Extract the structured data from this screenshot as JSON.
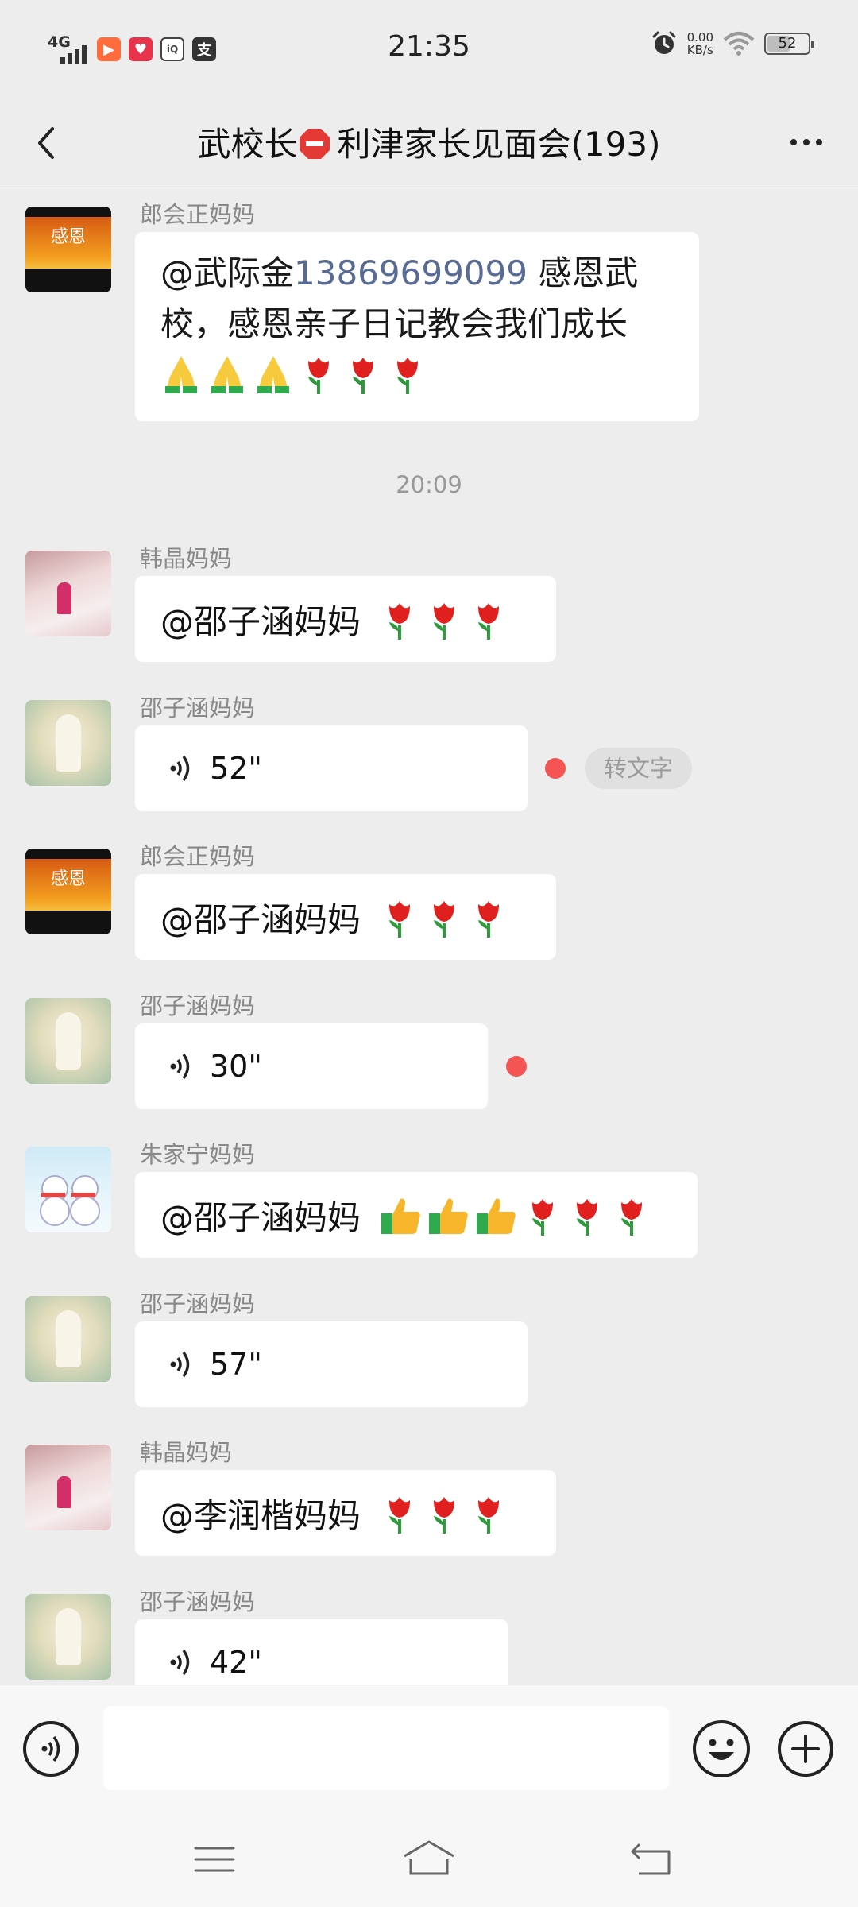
{
  "status_bar": {
    "network": "4G",
    "time": "21:35",
    "speed_value": "0.00",
    "speed_unit": "KB/s",
    "battery": "52",
    "app_icons": [
      "video-app-icon",
      "heart-app-icon",
      "iqiyi-app-icon",
      "alipay-app-icon"
    ]
  },
  "header": {
    "title_prefix": "武校长",
    "title_suffix": "利津家长见面会(193)",
    "title_emoji": "stop-sign-icon"
  },
  "messages": [
    {
      "sender": "郎会正妈妈",
      "type": "text",
      "mention": "@武际金",
      "phone": "13869699099",
      "text": " 感恩武校，感恩亲子日记教会我们成长",
      "emojis": [
        "pray",
        "pray",
        "pray",
        "rose",
        "rose",
        "rose"
      ]
    },
    {
      "type": "time",
      "time": "20:09"
    },
    {
      "sender": "韩晶妈妈",
      "type": "text",
      "mention": "@邵子涵妈妈",
      "emojis": [
        "rose",
        "rose",
        "rose"
      ]
    },
    {
      "sender": "邵子涵妈妈",
      "type": "voice",
      "duration": "52\"",
      "unread": true,
      "to_text": "转文字"
    },
    {
      "sender": "郎会正妈妈",
      "type": "text",
      "mention": "@邵子涵妈妈",
      "emojis": [
        "rose",
        "rose",
        "rose"
      ]
    },
    {
      "sender": "邵子涵妈妈",
      "type": "voice",
      "duration": "30\"",
      "unread": true
    },
    {
      "sender": "朱家宁妈妈",
      "type": "text",
      "mention": "@邵子涵妈妈",
      "emojis": [
        "thumb",
        "thumb",
        "thumb",
        "rose",
        "rose",
        "rose"
      ]
    },
    {
      "sender": "邵子涵妈妈",
      "type": "voice",
      "duration": "57\"",
      "unread": false
    },
    {
      "sender": "韩晶妈妈",
      "type": "text",
      "mention": "@李润楷妈妈",
      "emojis": [
        "rose",
        "rose",
        "rose"
      ]
    },
    {
      "sender": "邵子涵妈妈",
      "type": "voice",
      "duration": "42\"",
      "unread": false
    }
  ],
  "avatar_captions": {
    "gratitude": "感恩"
  },
  "colors": {
    "background": "#ededed",
    "bubble": "#ffffff",
    "link": "#576b95",
    "unread_dot": "#f45454",
    "sender_text": "#888888"
  }
}
